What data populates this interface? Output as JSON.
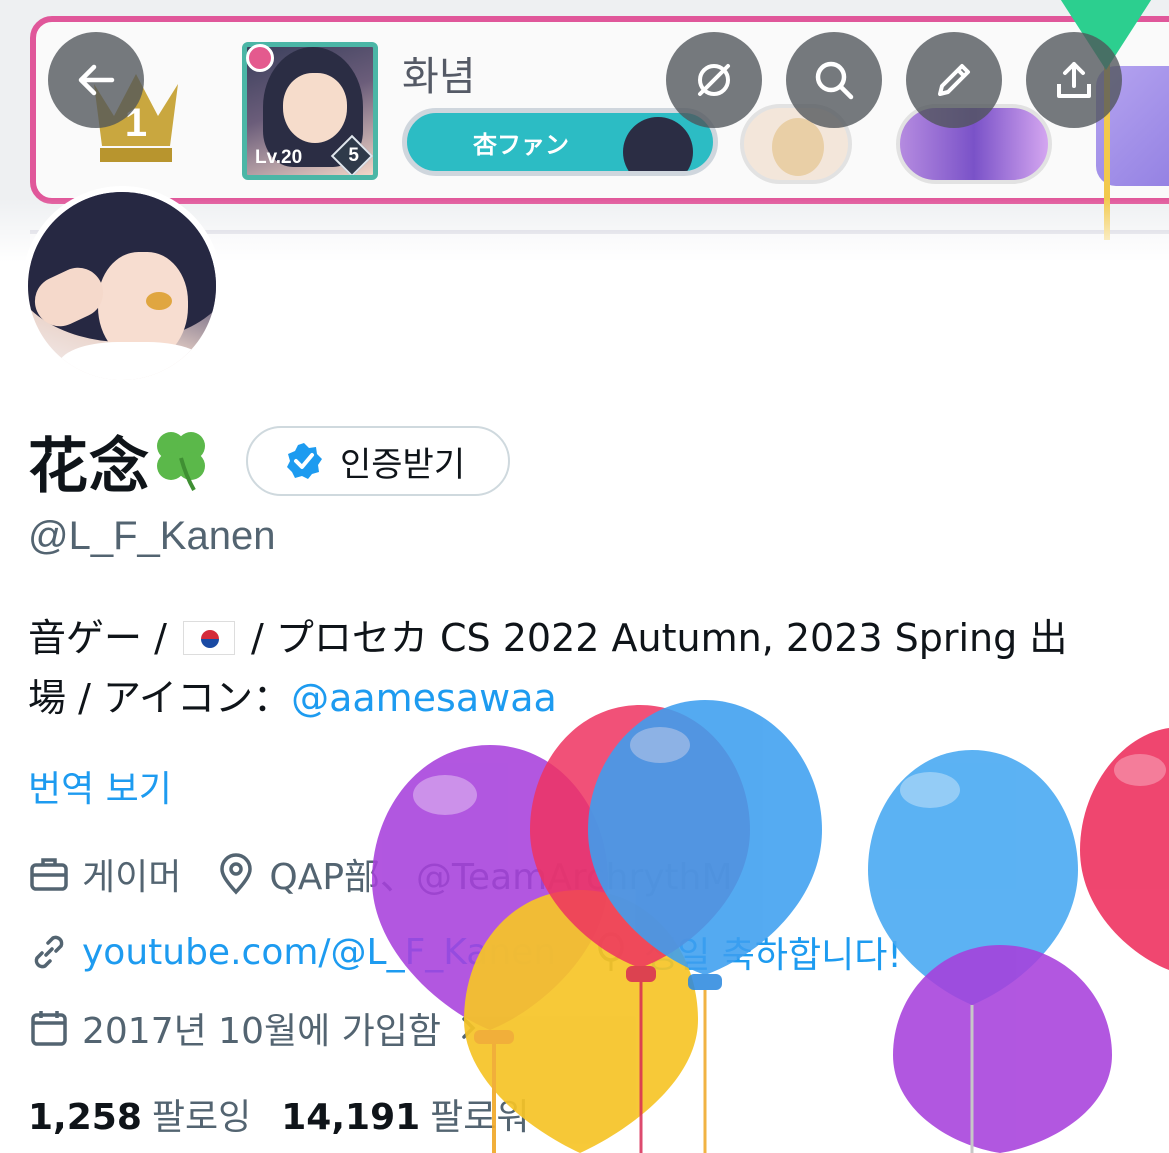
{
  "banner": {
    "player_name": "화념",
    "level": "Lv.20",
    "rank": "5",
    "fan_badge": "杏ファン",
    "crown_rank": "1"
  },
  "topbar": {
    "back_icon": "back-arrow-icon",
    "grok_icon": "grok-icon",
    "search_icon": "search-icon",
    "edit_icon": "pencil-icon",
    "share_icon": "share-icon"
  },
  "profile": {
    "display_name": "花念",
    "name_emoji": "four-leaf-clover",
    "verify_label": "인증받기",
    "handle": "@L_F_Kanen",
    "bio_line1": "音ゲー / ",
    "bio_line1b": " / プロセカ CS 2022 Autumn, 2023 Spring 出",
    "bio_line2": "場 / アイコン：",
    "bio_mention": "@aamesawaa",
    "translate": "번역 보기"
  },
  "meta": {
    "job": "게이머",
    "location": "QAP部、@TeamArchrythM",
    "website": "youtube.com/@L_F_Kanen",
    "birthday": "생일 축하합니다!",
    "joined": "2017년 10월에 가입함"
  },
  "stats": {
    "following_count": "1,258",
    "following_label": "팔로잉",
    "followers_count": "14,191",
    "followers_label": "팔로워"
  },
  "colors": {
    "accent": "#1d9bf0",
    "secondary_text": "#536471",
    "banner_frame": "#e0579a"
  }
}
